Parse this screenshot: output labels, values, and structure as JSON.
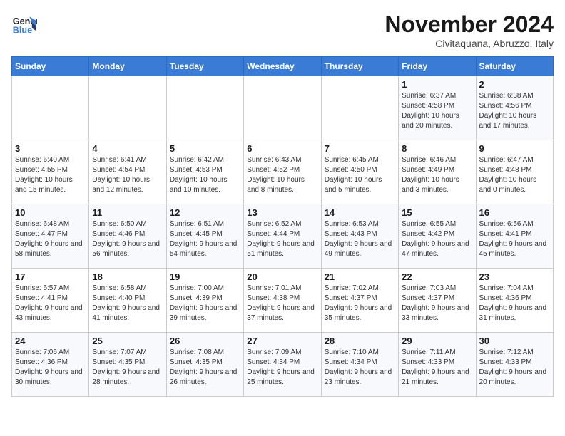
{
  "header": {
    "logo_line1": "General",
    "logo_line2": "Blue",
    "month": "November 2024",
    "location": "Civitaquana, Abruzzo, Italy"
  },
  "days_of_week": [
    "Sunday",
    "Monday",
    "Tuesday",
    "Wednesday",
    "Thursday",
    "Friday",
    "Saturday"
  ],
  "weeks": [
    [
      {
        "day": "",
        "info": ""
      },
      {
        "day": "",
        "info": ""
      },
      {
        "day": "",
        "info": ""
      },
      {
        "day": "",
        "info": ""
      },
      {
        "day": "",
        "info": ""
      },
      {
        "day": "1",
        "info": "Sunrise: 6:37 AM\nSunset: 4:58 PM\nDaylight: 10 hours and 20 minutes."
      },
      {
        "day": "2",
        "info": "Sunrise: 6:38 AM\nSunset: 4:56 PM\nDaylight: 10 hours and 17 minutes."
      }
    ],
    [
      {
        "day": "3",
        "info": "Sunrise: 6:40 AM\nSunset: 4:55 PM\nDaylight: 10 hours and 15 minutes."
      },
      {
        "day": "4",
        "info": "Sunrise: 6:41 AM\nSunset: 4:54 PM\nDaylight: 10 hours and 12 minutes."
      },
      {
        "day": "5",
        "info": "Sunrise: 6:42 AM\nSunset: 4:53 PM\nDaylight: 10 hours and 10 minutes."
      },
      {
        "day": "6",
        "info": "Sunrise: 6:43 AM\nSunset: 4:52 PM\nDaylight: 10 hours and 8 minutes."
      },
      {
        "day": "7",
        "info": "Sunrise: 6:45 AM\nSunset: 4:50 PM\nDaylight: 10 hours and 5 minutes."
      },
      {
        "day": "8",
        "info": "Sunrise: 6:46 AM\nSunset: 4:49 PM\nDaylight: 10 hours and 3 minutes."
      },
      {
        "day": "9",
        "info": "Sunrise: 6:47 AM\nSunset: 4:48 PM\nDaylight: 10 hours and 0 minutes."
      }
    ],
    [
      {
        "day": "10",
        "info": "Sunrise: 6:48 AM\nSunset: 4:47 PM\nDaylight: 9 hours and 58 minutes."
      },
      {
        "day": "11",
        "info": "Sunrise: 6:50 AM\nSunset: 4:46 PM\nDaylight: 9 hours and 56 minutes."
      },
      {
        "day": "12",
        "info": "Sunrise: 6:51 AM\nSunset: 4:45 PM\nDaylight: 9 hours and 54 minutes."
      },
      {
        "day": "13",
        "info": "Sunrise: 6:52 AM\nSunset: 4:44 PM\nDaylight: 9 hours and 51 minutes."
      },
      {
        "day": "14",
        "info": "Sunrise: 6:53 AM\nSunset: 4:43 PM\nDaylight: 9 hours and 49 minutes."
      },
      {
        "day": "15",
        "info": "Sunrise: 6:55 AM\nSunset: 4:42 PM\nDaylight: 9 hours and 47 minutes."
      },
      {
        "day": "16",
        "info": "Sunrise: 6:56 AM\nSunset: 4:41 PM\nDaylight: 9 hours and 45 minutes."
      }
    ],
    [
      {
        "day": "17",
        "info": "Sunrise: 6:57 AM\nSunset: 4:41 PM\nDaylight: 9 hours and 43 minutes."
      },
      {
        "day": "18",
        "info": "Sunrise: 6:58 AM\nSunset: 4:40 PM\nDaylight: 9 hours and 41 minutes."
      },
      {
        "day": "19",
        "info": "Sunrise: 7:00 AM\nSunset: 4:39 PM\nDaylight: 9 hours and 39 minutes."
      },
      {
        "day": "20",
        "info": "Sunrise: 7:01 AM\nSunset: 4:38 PM\nDaylight: 9 hours and 37 minutes."
      },
      {
        "day": "21",
        "info": "Sunrise: 7:02 AM\nSunset: 4:37 PM\nDaylight: 9 hours and 35 minutes."
      },
      {
        "day": "22",
        "info": "Sunrise: 7:03 AM\nSunset: 4:37 PM\nDaylight: 9 hours and 33 minutes."
      },
      {
        "day": "23",
        "info": "Sunrise: 7:04 AM\nSunset: 4:36 PM\nDaylight: 9 hours and 31 minutes."
      }
    ],
    [
      {
        "day": "24",
        "info": "Sunrise: 7:06 AM\nSunset: 4:36 PM\nDaylight: 9 hours and 30 minutes."
      },
      {
        "day": "25",
        "info": "Sunrise: 7:07 AM\nSunset: 4:35 PM\nDaylight: 9 hours and 28 minutes."
      },
      {
        "day": "26",
        "info": "Sunrise: 7:08 AM\nSunset: 4:35 PM\nDaylight: 9 hours and 26 minutes."
      },
      {
        "day": "27",
        "info": "Sunrise: 7:09 AM\nSunset: 4:34 PM\nDaylight: 9 hours and 25 minutes."
      },
      {
        "day": "28",
        "info": "Sunrise: 7:10 AM\nSunset: 4:34 PM\nDaylight: 9 hours and 23 minutes."
      },
      {
        "day": "29",
        "info": "Sunrise: 7:11 AM\nSunset: 4:33 PM\nDaylight: 9 hours and 21 minutes."
      },
      {
        "day": "30",
        "info": "Sunrise: 7:12 AM\nSunset: 4:33 PM\nDaylight: 9 hours and 20 minutes."
      }
    ]
  ]
}
